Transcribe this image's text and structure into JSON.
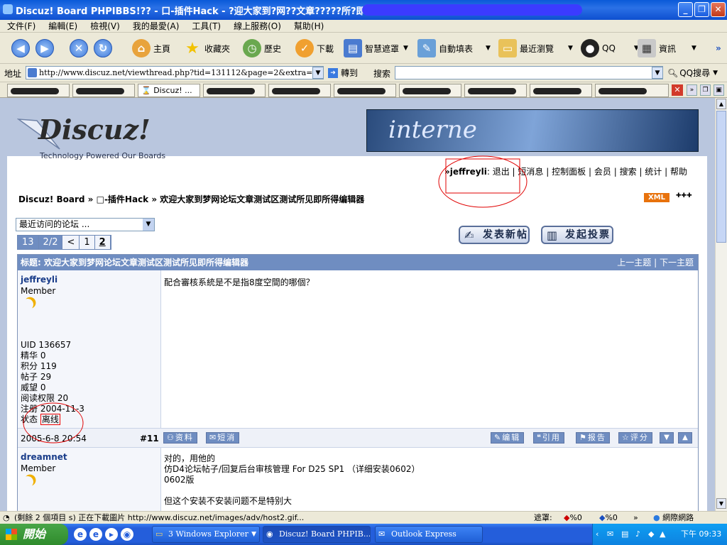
{
  "window": {
    "title": "Discuz! Board PHPIBBS!?? - 口-插件Hack - ?迎大家到?网??文章?????所?即所得??器 -",
    "min_icon": "minimize-icon",
    "max_icon": "restore-icon",
    "close_icon": "close-icon"
  },
  "menu": [
    "文件(F)",
    "編輯(E)",
    "檢視(V)",
    "我的最愛(A)",
    "工具(T)",
    "線上服務(O)",
    "幫助(H)"
  ],
  "toolbar": {
    "home": "主頁",
    "favorites": "收藏夾",
    "history": "歷史",
    "download": "下載",
    "smart_block": "智慧遮罩",
    "autofill": "自動填表",
    "recent": "最近瀏覽",
    "qq": "QQ",
    "info": "資訊",
    "more": "»"
  },
  "address": {
    "label": "地址",
    "url": "http://www.discuz.net/viewthread.php?tid=131112&page=2&extra=page%3D1",
    "go": "轉到",
    "search_label": "搜索",
    "qq_search": "QQ搜尋"
  },
  "tabs": {
    "active_label": "Discuz! ..."
  },
  "forum": {
    "banner_text": "interne",
    "logo_text": "Discuz!",
    "logo_tagline": "Technology Powered Our Boards",
    "user_prefix": "»",
    "username": "jeffreyli",
    "links": [
      ": 退出",
      "短消息",
      "控制面板",
      "会员",
      "搜索",
      "统计",
      "帮助"
    ],
    "breadcrumb": "Discuz! Board » □-插件Hack » 欢迎大家到梦网论坛文章测试区测试所见即所得编辑器",
    "xml": "XML",
    "jump_select": "最近访问的论坛 ...",
    "pager": [
      "13",
      "2/2",
      "<",
      "1",
      "2"
    ],
    "new_thread": "发表新帖",
    "new_poll": "发起投票",
    "thread_title": "标题: 欢迎大家到梦网论坛文章测试区测试所见即所得编辑器",
    "prev_topic": "上一主题",
    "next_topic": "下一主题",
    "nav_sep": "|",
    "posts": [
      {
        "author": "jeffreyli",
        "rank": "Member",
        "profile": [
          "UID 136657",
          "精华 0",
          "积分 119",
          "帖子 29",
          "威望 0",
          "阅读权限 20",
          "注册 2004-11-3"
        ],
        "status_label": "状态",
        "status": "离线",
        "message": "配合審核系統是不是指8度空間的哪個？",
        "date": "2005-6-8 20:54",
        "floor": "#11",
        "profile_btn": "资料",
        "pm_btn": "短消",
        "actions": [
          "编辑",
          "引用",
          "报告",
          "评分"
        ]
      },
      {
        "author": "dreamnet",
        "rank": "Member",
        "message_lines": [
          "对的，用他的",
          "仿D4论坛帖子/回复后台审核管理 For D25 SP1 （详细安装0602）",
          "0602版",
          "",
          "但这个安装不安装问题不是特别大"
        ]
      }
    ]
  },
  "status": {
    "text": "(剩餘 2 個項目 s) 正在下載圖片 http://www.discuz.net/images/adv/host2.gif...",
    "block_label": "遮罩:",
    "block1": "%0",
    "block2": "%0",
    "zone": "網際網路"
  },
  "taskbar": {
    "start": "開始",
    "tasks": [
      "3 Windows Explorer",
      "Discuz! Board PHPIB...",
      "Outlook Express"
    ],
    "clock": "下午 09:33"
  },
  "colors": {
    "accent": "#6f8dc1",
    "title_bar": "#0a5ad8",
    "annotation": "#e00000"
  }
}
